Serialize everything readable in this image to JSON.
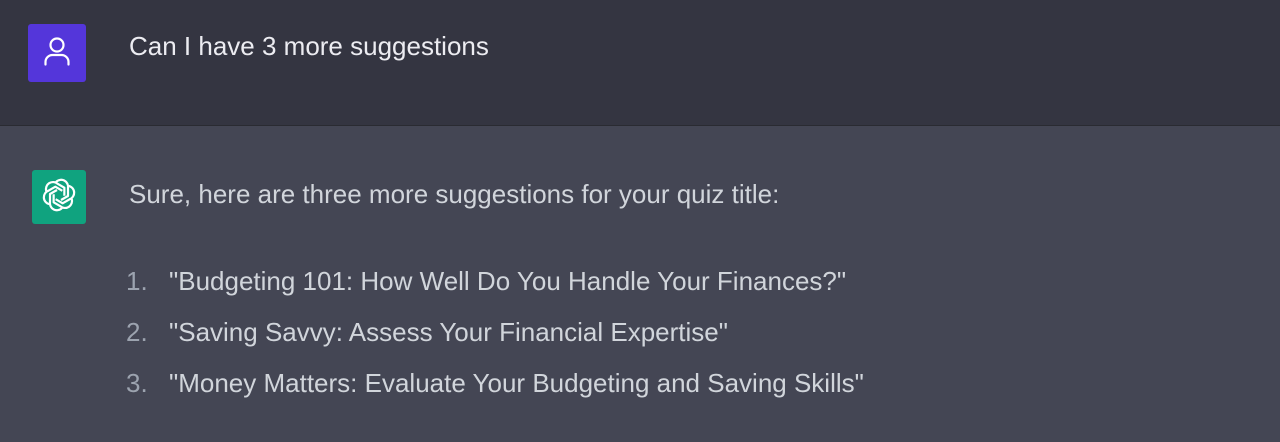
{
  "user_message": {
    "avatar_icon": "user-icon",
    "avatar_color": "#5436DA",
    "text": "Can I have 3 more suggestions"
  },
  "assistant_message": {
    "avatar_icon": "openai-logo-icon",
    "avatar_color": "#10A37F",
    "intro": "Sure, here are three more suggestions for your quiz title:",
    "items": [
      {
        "number": "1.",
        "text": "\"Budgeting 101: How Well Do You Handle Your Finances?\""
      },
      {
        "number": "2.",
        "text": "\"Saving Savvy: Assess Your Financial Expertise\""
      },
      {
        "number": "3.",
        "text": "\"Money Matters: Evaluate Your Budgeting and Saving Skills\""
      }
    ]
  },
  "colors": {
    "user_turn_bg": "#343541",
    "assistant_turn_bg": "#444654",
    "text_primary": "#ECECF1",
    "text_secondary": "#D1D5DB",
    "list_number": "#9CA3AF"
  }
}
